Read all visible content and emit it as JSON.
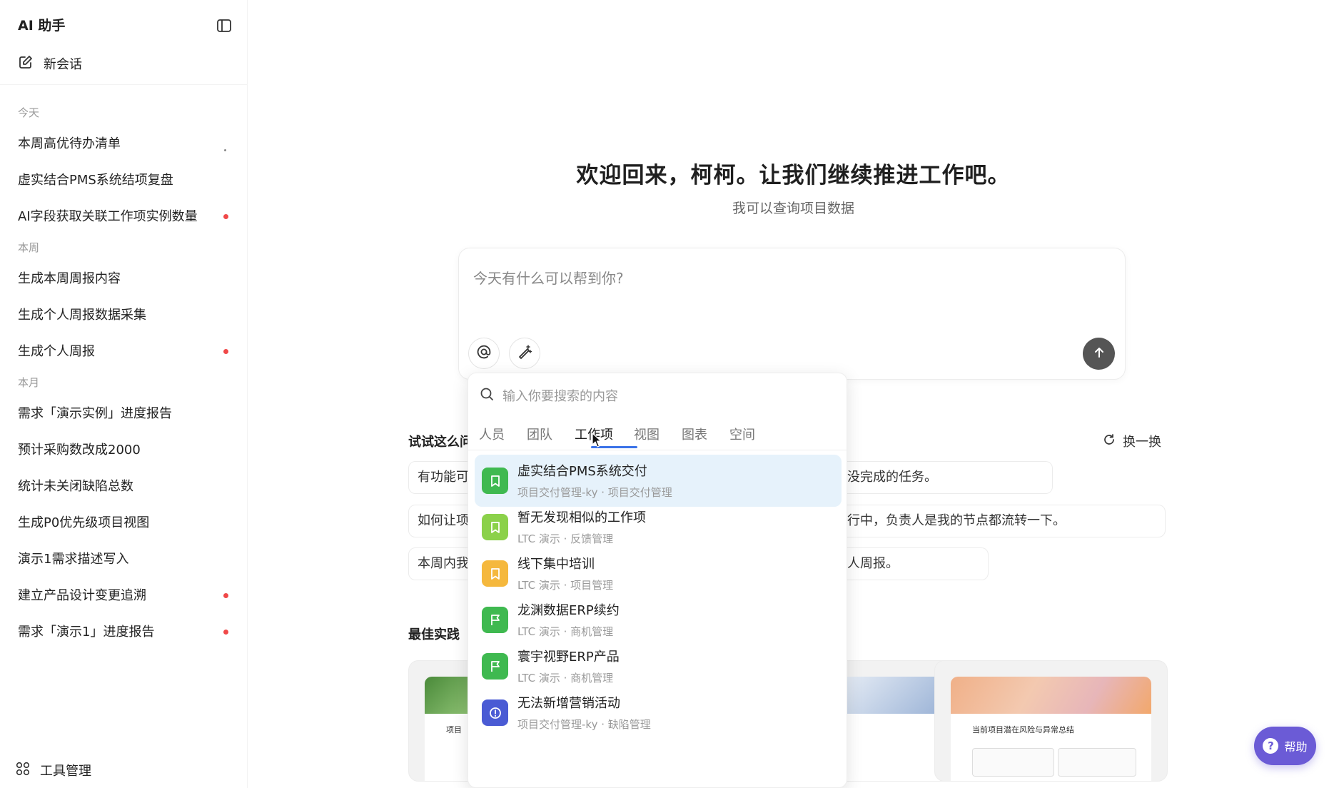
{
  "sidebar": {
    "title": "AI 助手",
    "new_chat": "新会话",
    "sections": [
      {
        "label": "今天",
        "items": [
          {
            "label": "本周高优待办清单",
            "marker": "small"
          },
          {
            "label": "虚实结合PMS系统结项复盘",
            "marker": ""
          },
          {
            "label": "AI字段获取关联工作项实例数量",
            "marker": "dot"
          }
        ]
      },
      {
        "label": "本周",
        "items": [
          {
            "label": "生成本周周报内容",
            "marker": ""
          },
          {
            "label": "生成个人周报数据采集",
            "marker": ""
          },
          {
            "label": "生成个人周报",
            "marker": "dot"
          }
        ]
      },
      {
        "label": "本月",
        "items": [
          {
            "label": "需求「演示实例」进度报告",
            "marker": ""
          },
          {
            "label": "预计采购数改成2000",
            "marker": ""
          },
          {
            "label": "统计未关闭缺陷总数",
            "marker": ""
          },
          {
            "label": "生成P0优先级项目视图",
            "marker": ""
          },
          {
            "label": "演示1需求描述写入",
            "marker": ""
          },
          {
            "label": "建立产品设计变更追溯",
            "marker": "dot"
          },
          {
            "label": "需求「演示1」进度报告",
            "marker": "dot"
          }
        ]
      }
    ],
    "footer": "工具管理"
  },
  "main": {
    "welcome": "欢迎回来，柯柯。让我们继续推进工作吧。",
    "subtitle": "我可以查询项目数据",
    "composer_placeholder": "今天有什么可以帮到你?",
    "try_title": "试试这么问",
    "refresh": "换一换",
    "chips": [
      {
        "left_text": "有功能可",
        "right_text": "没完成的任务。"
      },
      {
        "left_text": "如何让项",
        "right_text": "行中，负责人是我的节点都流转一下。"
      },
      {
        "left_text": "本周内我",
        "right_text": "人周报。"
      }
    ],
    "best_title": "最佳实践",
    "cards": [
      {
        "caption": "项目"
      },
      {
        "caption": ""
      },
      {
        "caption": "当前项目潜在风险与异常总结"
      }
    ],
    "help": "帮助"
  },
  "popup": {
    "search_placeholder": "输入你要搜索的内容",
    "tabs": [
      "人员",
      "团队",
      "工作项",
      "视图",
      "图表",
      "空间"
    ],
    "active_tab": "工作项",
    "items": [
      {
        "name": "虚实结合PMS系统交付",
        "meta": "项目交付管理-ky · 项目交付管理",
        "icon": "bookmark-icon",
        "color": "#3fb950"
      },
      {
        "name": "暂无发现相似的工作项",
        "meta": "LTC 演示 · 反馈管理",
        "icon": "bookmark-icon",
        "color": "#8bd14a"
      },
      {
        "name": "线下集中培训",
        "meta": "LTC 演示 · 项目管理",
        "icon": "bookmark-icon",
        "color": "#f5b83d"
      },
      {
        "name": "龙渊数据ERP续约",
        "meta": "LTC 演示 · 商机管理",
        "icon": "flag-icon",
        "color": "#3fb950"
      },
      {
        "name": "寰宇视野ERP产品",
        "meta": "LTC 演示 · 商机管理",
        "icon": "flag-icon",
        "color": "#3fb950"
      },
      {
        "name": "无法新增营销活动",
        "meta": "项目交付管理-ky · 缺陷管理",
        "icon": "alert-icon",
        "color": "#4a5bd4"
      }
    ]
  }
}
